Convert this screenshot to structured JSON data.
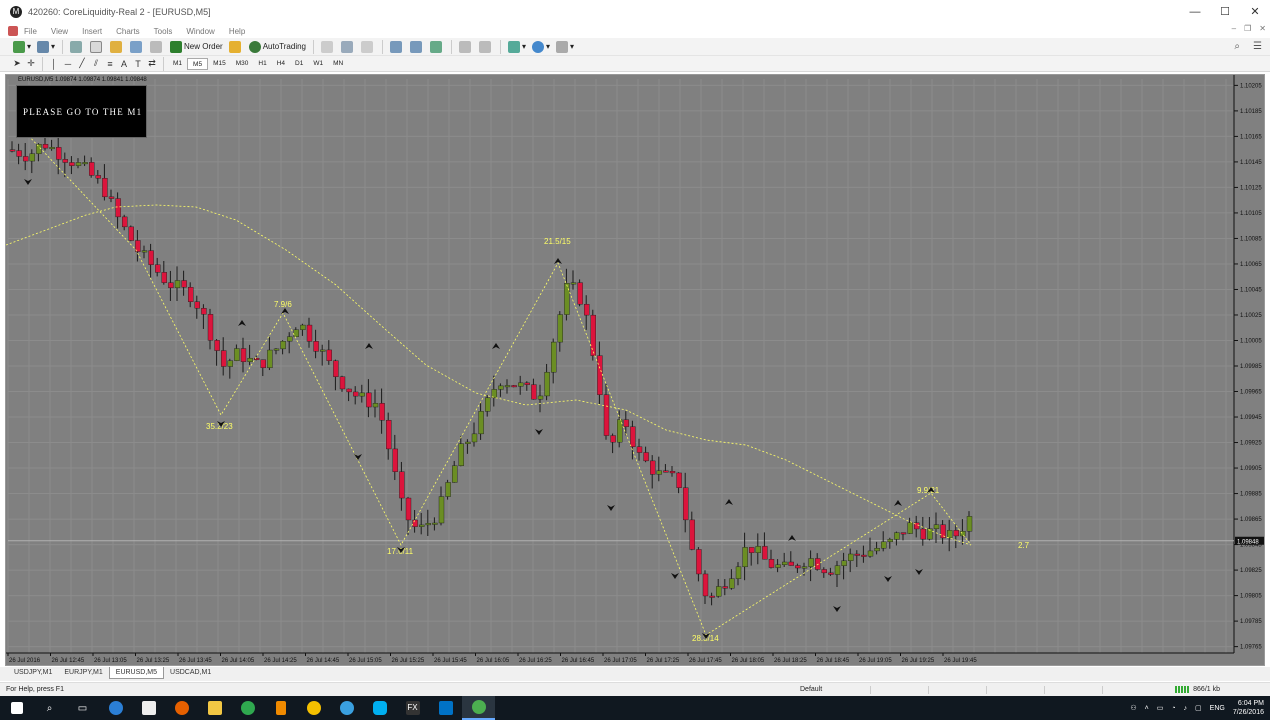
{
  "window": {
    "title": "420260: CoreLiquidity-Real 2 - [EURUSD,M5]",
    "buttons": [
      "—",
      "☐",
      "✕"
    ]
  },
  "menu": [
    "File",
    "View",
    "Insert",
    "Charts",
    "Tools",
    "Window",
    "Help"
  ],
  "toolbar": {
    "new_order": "New Order",
    "autotrading": "AutoTrading"
  },
  "timeframes": [
    "M1",
    "M5",
    "M15",
    "M30",
    "H1",
    "H4",
    "D1",
    "W1",
    "MN"
  ],
  "active_timeframe": "M5",
  "chart": {
    "symbol_info": "EURUSD,M5  1.09874  1.09874  1.09841  1.09848",
    "notice": "PLEASE GO TO THE M1",
    "current_price": "1.09848",
    "colors": {
      "background": "#808080",
      "bull": "#6b8e23",
      "bear": "#dc143c",
      "zigzag": "#ffff66",
      "label": "#ffff66"
    }
  },
  "chart_data": {
    "type": "candlestick",
    "y_ticks": [
      "1.10205",
      "1.10185",
      "1.10165",
      "1.10145",
      "1.10125",
      "1.10105",
      "1.10085",
      "1.10065",
      "1.10045",
      "1.10025",
      "1.10005",
      "1.09985",
      "1.09965",
      "1.09945",
      "1.09925",
      "1.09905",
      "1.09885",
      "1.09865",
      "1.09845",
      "1.09825",
      "1.09805",
      "1.09785",
      "1.09765"
    ],
    "x_ticks": [
      "26 Jul 2016",
      "26 Jul 12:45",
      "26 Jul 13:05",
      "26 Jul 13:25",
      "26 Jul 13:45",
      "26 Jul 14:05",
      "26 Jul 14:25",
      "26 Jul 14:45",
      "26 Jul 15:05",
      "26 Jul 15:25",
      "26 Jul 15:45",
      "26 Jul 16:05",
      "26 Jul 16:25",
      "26 Jul 16:45",
      "26 Jul 17:05",
      "26 Jul 17:25",
      "26 Jul 17:45",
      "26 Jul 18:05",
      "26 Jul 18:25",
      "26 Jul 18:45",
      "26 Jul 19:05",
      "26 Jul 19:25",
      "26 Jul 19:45"
    ],
    "ylim": [
      1.0976,
      1.1021
    ],
    "zigzag_labels": [
      {
        "text": "7.9/6"
      },
      {
        "text": "35.2/23"
      },
      {
        "text": "17.6/11"
      },
      {
        "text": "21.5/15"
      },
      {
        "text": "28.3/14"
      },
      {
        "text": "9.9/21"
      },
      {
        "text": "2.7"
      }
    ]
  },
  "tabs": [
    "USDJPY,M1",
    "EURJPY,M1",
    "EURUSD,M5",
    "USDCAD,M1"
  ],
  "active_tab": "EURUSD,M5",
  "status": {
    "help": "For Help, press F1",
    "profile": "Default",
    "traffic": "866/1 kb"
  },
  "taskbar": {
    "time": "6:04 PM",
    "date": "7/26/2016",
    "lang": "ENG"
  }
}
